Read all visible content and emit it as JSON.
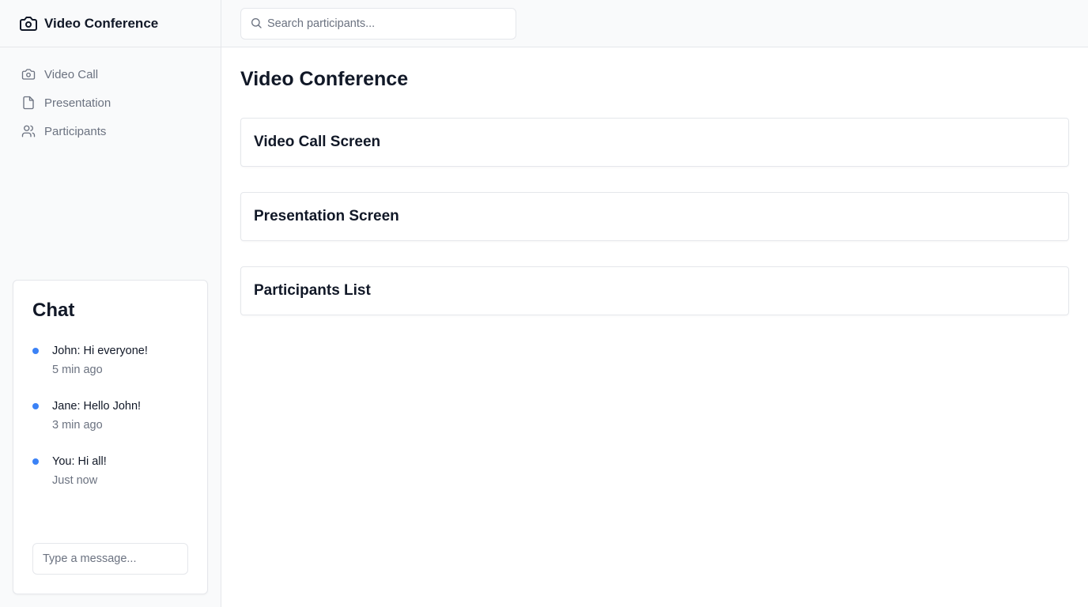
{
  "app": {
    "title": "Video Conference"
  },
  "sidebar": {
    "items": [
      {
        "label": "Video Call",
        "icon": "camera-icon"
      },
      {
        "label": "Presentation",
        "icon": "file-icon"
      },
      {
        "label": "Participants",
        "icon": "users-icon"
      }
    ]
  },
  "chat": {
    "title": "Chat",
    "messages": [
      {
        "text": "John: Hi everyone!",
        "time": "5 min ago"
      },
      {
        "text": "Jane: Hello John!",
        "time": "3 min ago"
      },
      {
        "text": "You: Hi all!",
        "time": "Just now"
      }
    ],
    "input_placeholder": "Type a message...",
    "dot_color": "#3b82f6"
  },
  "header": {
    "search_placeholder": "Search participants..."
  },
  "main": {
    "title": "Video Conference",
    "cards": [
      {
        "title": "Video Call Screen"
      },
      {
        "title": "Presentation Screen"
      },
      {
        "title": "Participants List"
      }
    ]
  }
}
